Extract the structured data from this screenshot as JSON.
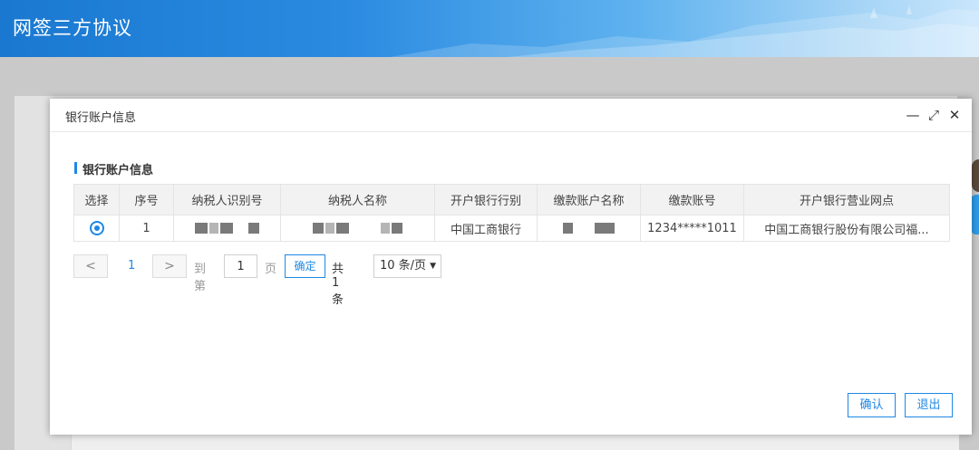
{
  "app": {
    "title": "网签三方协议"
  },
  "modal": {
    "title": "银行账户信息",
    "controls": {
      "minimize": "—",
      "maximize": "⤢",
      "close": "✕"
    }
  },
  "section": {
    "title": "银行账户信息"
  },
  "table": {
    "headers": [
      "选择",
      "序号",
      "纳税人识别号",
      "纳税人名称",
      "开户银行行别",
      "缴款账户名称",
      "缴款账号",
      "开户银行营业网点"
    ],
    "rows": [
      {
        "index": "1",
        "bank_type": "中国工商银行",
        "account_no": "1234*****1011",
        "branch": "中国工商银行股份有限公司福..."
      }
    ]
  },
  "pager": {
    "prev": "<",
    "current_page": "1",
    "next": ">",
    "goto_label": "到第",
    "goto_value": "1",
    "page_label": "页",
    "confirm_label": "确定",
    "total_label": "共 1 条",
    "page_size": "10 条/页"
  },
  "footer": {
    "ok_label": "确认",
    "exit_label": "退出"
  },
  "colors": {
    "accent": "#1e88e5",
    "header_start": "#1a78d0",
    "header_end": "#c9e6fb"
  }
}
